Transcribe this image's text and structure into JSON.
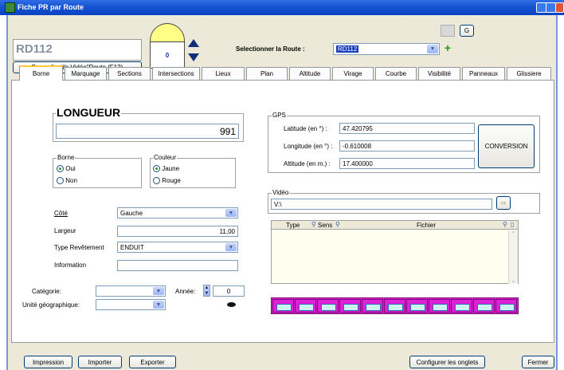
{
  "window": {
    "title": "Fiche PR par Route"
  },
  "header": {
    "route_code": "RD112",
    "toolbar_button": "Barre d'outils Vidéo\"Route (F12)",
    "counter_value": "0",
    "select_label": "Selectionner la Route :",
    "selected_route": "RD112",
    "g_button": "G"
  },
  "tabs": [
    "Borne",
    "Marquage",
    "Sections",
    "Intersections",
    "Lieux",
    "Plan",
    "Altitude",
    "Virage",
    "Courbe",
    "Visibilité",
    "Panneaux",
    "Glissiere"
  ],
  "active_tab": "Borne",
  "borne": {
    "longueur_label": "LONGUEUR",
    "longueur_value": "991",
    "borne_group": "Borne",
    "borne_options": [
      "Oui",
      "Non"
    ],
    "couleur_group": "Couleur",
    "couleur_options": [
      "Jaune",
      "Rouge"
    ],
    "cote_label": "Côté",
    "cote_value": "Gauche",
    "largeur_label": "Largeur",
    "largeur_value": "11,00",
    "revetement_label": "Type Revêtement",
    "revetement_value": "ENDUIT",
    "information_label": "Information",
    "information_value": "",
    "categorie_label": "Catégorie:",
    "categorie_value": "",
    "annee_label": "Année:",
    "annee_value": "0",
    "unite_label": "Unité géographique:",
    "unite_value": ""
  },
  "gps": {
    "group": "GPS",
    "latitude_label": "Latitude (en °) :",
    "latitude_value": "47.420795",
    "longitude_label": "Longitude (en °) :",
    "longitude_value": "-0.610008",
    "altitude_label": "Altitude (en m.) :",
    "altitude_value": "17.400000",
    "conversion_button": "CONVERSION"
  },
  "video": {
    "group": "Vidéo",
    "path_value": "V:\\",
    "columns": [
      "Type",
      "Sens",
      "Fichier"
    ]
  },
  "footer": {
    "impression": "Impression",
    "importer": "Importer",
    "exporter": "Exporter",
    "configurer": "Configurer les onglets",
    "fermer": "Fermer"
  },
  "colors": {
    "titlebar": "#0a43c3",
    "window_bg": "#ece9d8",
    "tab_active_accent": "#ffc83c",
    "filmstrip": "#e020d8"
  }
}
